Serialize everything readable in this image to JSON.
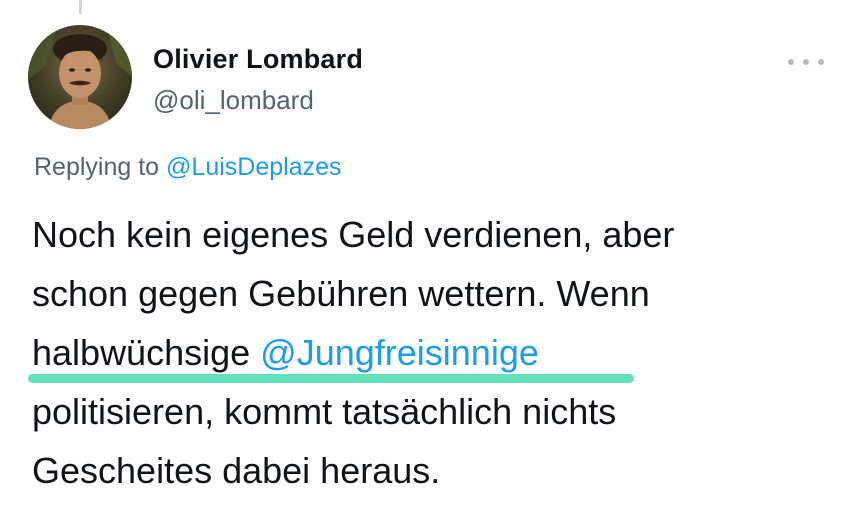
{
  "tweet": {
    "author": {
      "display_name": "Olivier Lombard",
      "handle": "@oli_lombard",
      "avatar_icon": "profile-photo"
    },
    "more_icon": "more-horizontal-icon",
    "replying_to_prefix": "Replying to",
    "replying_to_handle": "@LuisDeplazes",
    "text": {
      "line1": "Noch kein eigenes Geld verdienen, aber",
      "line2": "schon gegen Gebühren wettern. Wenn",
      "line3_prefix": "halbwüchsige ",
      "line3_mention": "@Jungfreisinnige",
      "line4": "politisieren, kommt tatsächlich nichts",
      "line5": "Gescheites dabei heraus."
    },
    "highlight_color": "#55e0b5",
    "link_color": "#1d9bf0",
    "secondary_text_color": "#536471"
  }
}
